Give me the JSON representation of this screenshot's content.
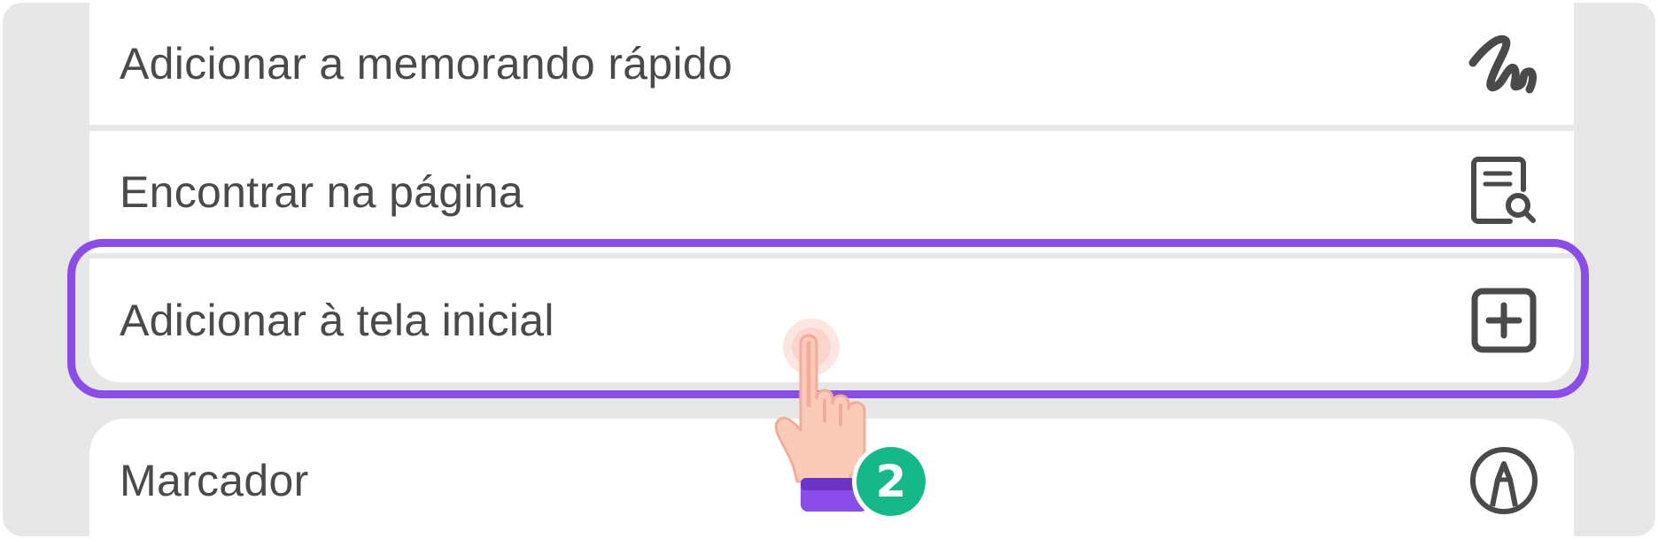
{
  "menu": {
    "items": [
      {
        "label": "Adicionar a memorando rápido",
        "icon": "quick-memo-squiggle-icon"
      },
      {
        "label": "Encontrar na página",
        "icon": "find-in-page-icon"
      },
      {
        "label": "Adicionar à tela inicial",
        "icon": "add-square-icon"
      },
      {
        "label": "Marcador",
        "icon": "marker-pen-icon"
      }
    ]
  },
  "tutorial": {
    "step_number": "2",
    "highlight_color": "#8a4de8",
    "badge_color": "#16b88a"
  }
}
